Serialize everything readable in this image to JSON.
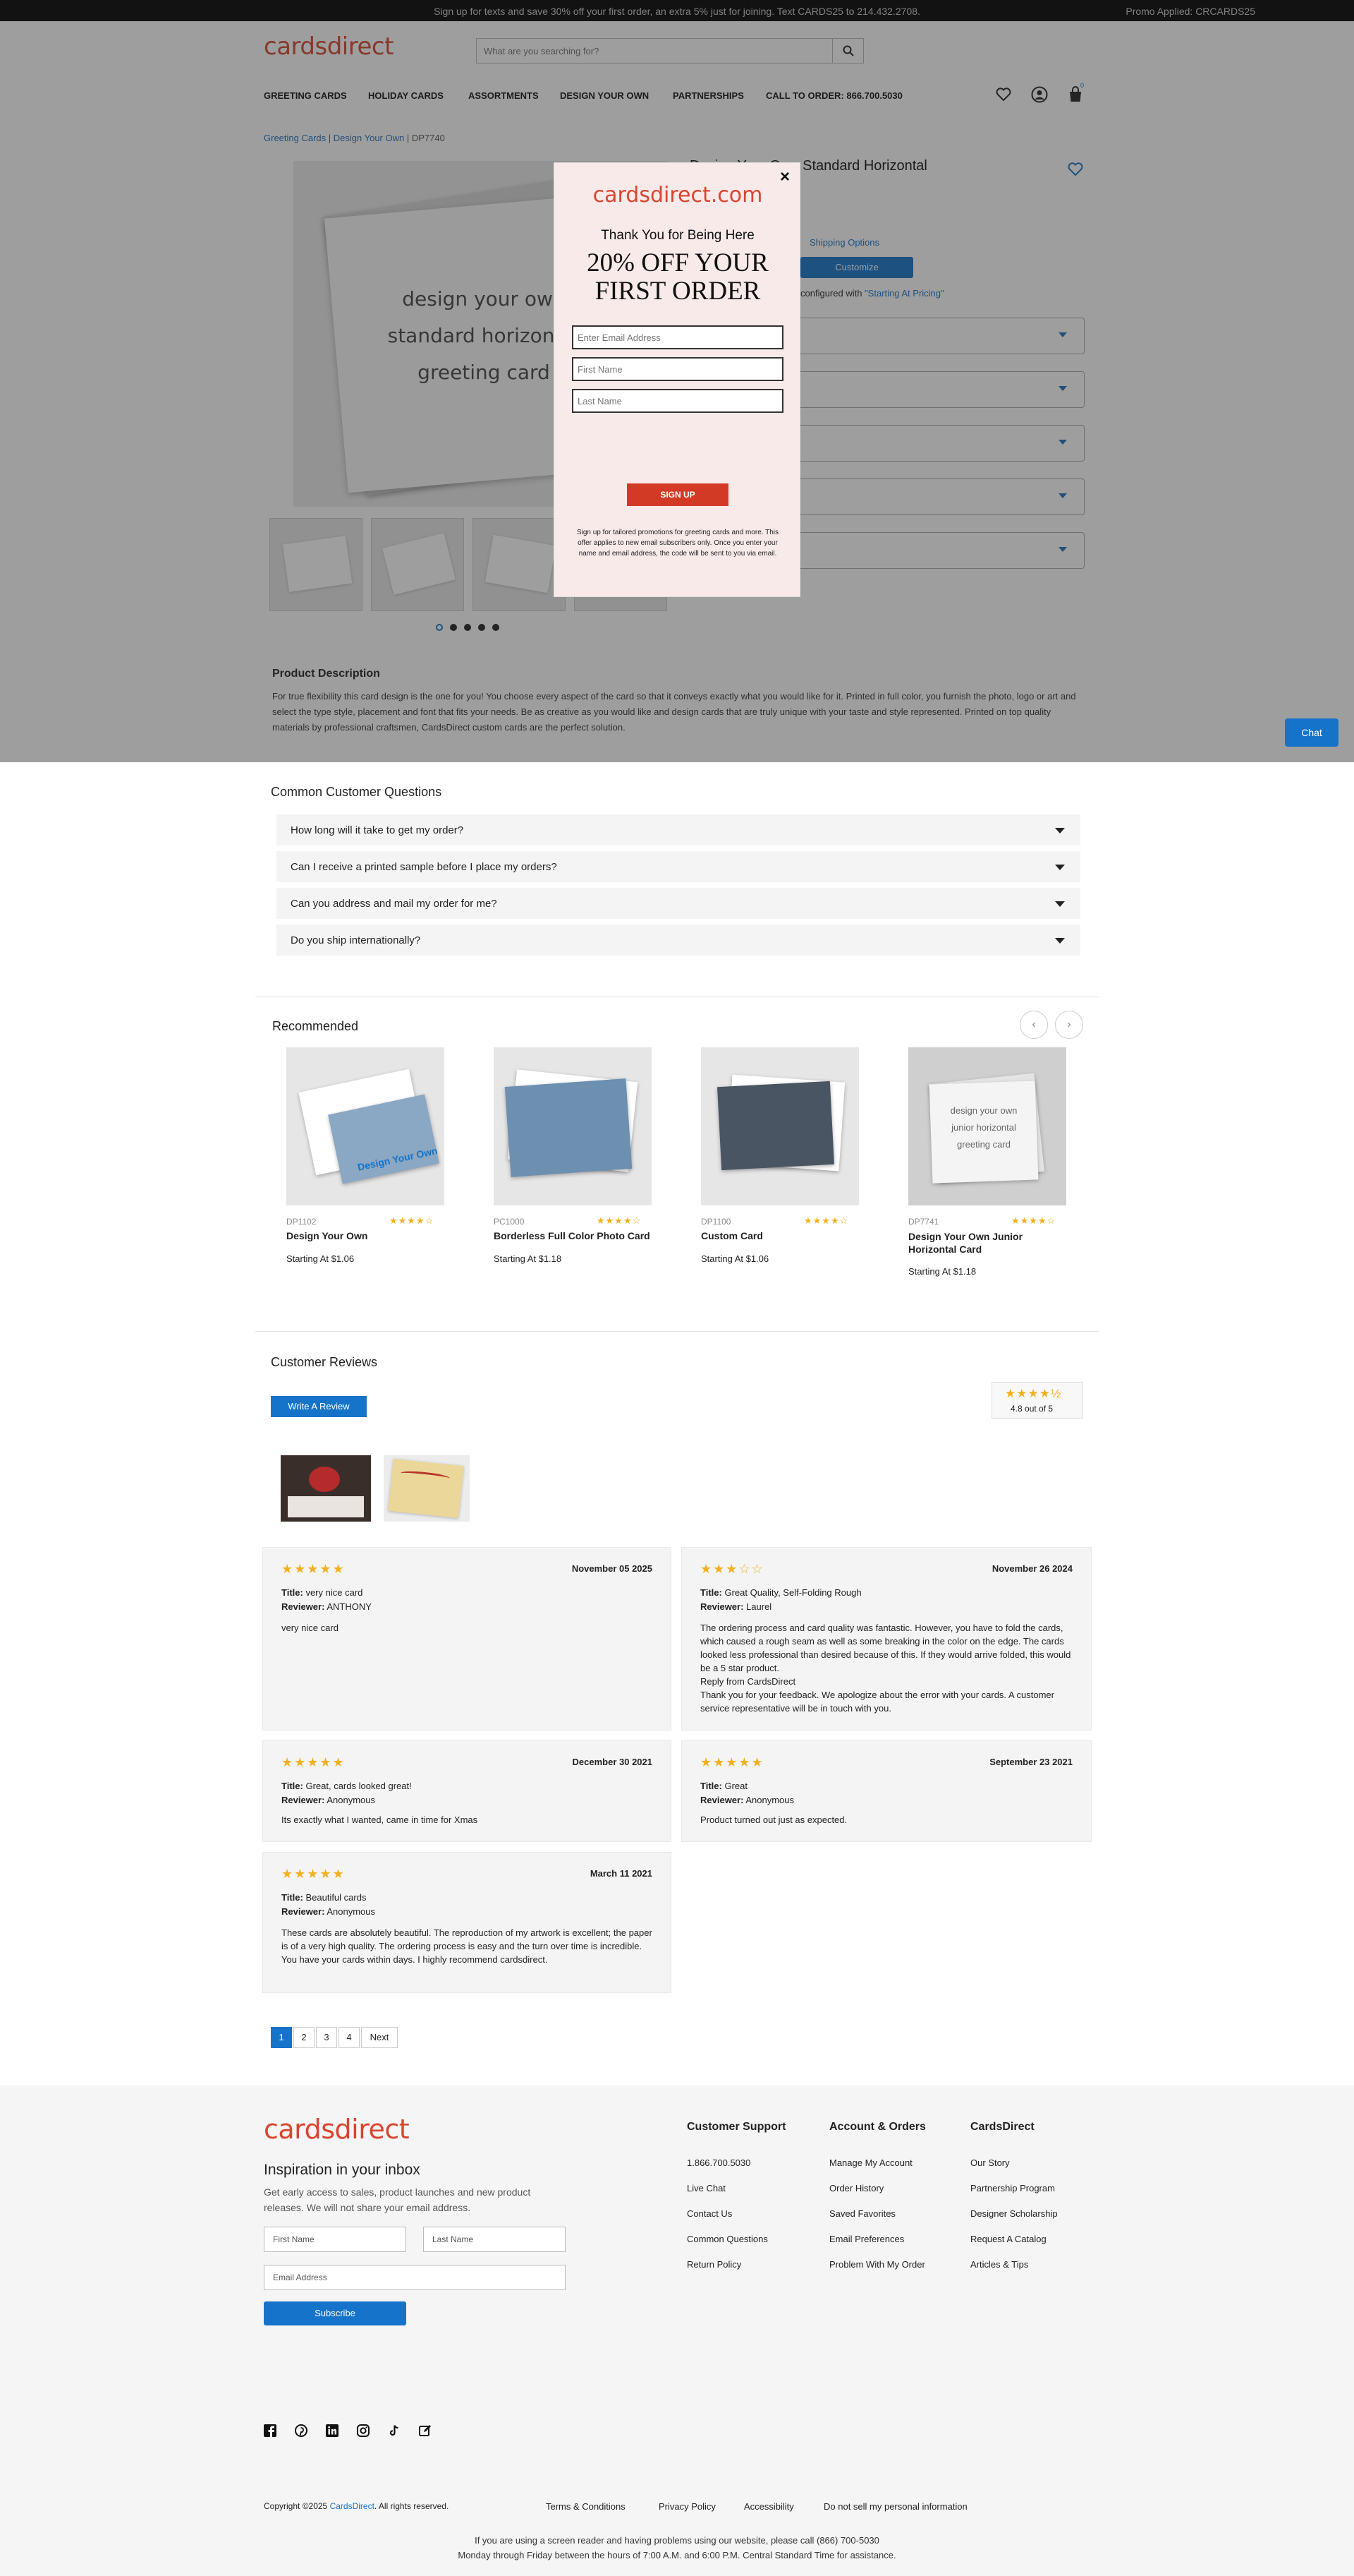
{
  "topbar": {
    "message": "Sign up for texts and save 30% off your first order, an extra 5% just for joining. Text CARDS25 to 214.432.2708.",
    "promo": "Promo Applied: CRCARDS25"
  },
  "header": {
    "logo": "cardsdirect",
    "search_placeholder": "What are you searching for?",
    "cart_count": "0"
  },
  "nav": [
    "GREETING CARDS",
    "HOLIDAY CARDS",
    "ASSORTMENTS",
    "DESIGN YOUR OWN",
    "PARTNERSHIPS",
    "CALL TO ORDER: 866.700.5030"
  ],
  "breadcrumb": {
    "a": "Greeting Cards",
    "sep1": " | ",
    "b": "Design Your Own",
    "sep2": " | ",
    "c": "DP7740"
  },
  "product": {
    "title": "Design Your Own Standard Horizontal",
    "image_text": [
      "design your own",
      "standard horizontal",
      "greeting card"
    ],
    "shipping_link": "Shipping Options",
    "customize": "Customize",
    "configured_pre": "configured with ",
    "configured_link": "\"Starting At Pricing\"",
    "description_title": "Product Description",
    "description": "For true flexibility this card design is the one for you! You choose every aspect of the card so that it conveys exactly what you would like for it. Printed in full color, you furnish the photo, logo or art and select the type style, placement and font that fits your needs. Be as creative as you would like and design cards that are truly unique with your taste and style represented. Printed on top quality materials by professional craftsmen, CardsDirect custom cards are the perfect solution."
  },
  "chat": "Chat",
  "modal": {
    "logo": "cardsdirect.com",
    "thanks": "Thank You for Being Here",
    "offer_line1": "20% OFF YOUR",
    "offer_line2": "FIRST ORDER",
    "email_placeholder": "Enter Email Address",
    "first_placeholder": "First Name",
    "last_placeholder": "Last Name",
    "signup": "SIGN UP",
    "fine_print": "Sign up for tailored promotions for greeting cards and more. This offer applies to new email subscribers only. Once you enter your name and email address, the code will be sent to you via email."
  },
  "questions": {
    "title": "Common Customer Questions",
    "items": [
      "How long will it take to get my order?",
      "Can I receive a printed sample before I place my orders?",
      "Can you address and mail my order for me?",
      "Do you ship internationally?"
    ]
  },
  "recommended": {
    "title": "Recommended",
    "items": [
      {
        "sku": "DP1102",
        "name": "Design Your Own",
        "price": "Starting At $1.06",
        "stars": "★★★★☆",
        "art": "Design Your Own"
      },
      {
        "sku": "PC1000",
        "name": "Borderless Full Color Photo Card",
        "price": "Starting At $1.18",
        "stars": "★★★★☆"
      },
      {
        "sku": "DP1100",
        "name": "Custom Card",
        "price": "Starting At $1.06",
        "stars": "★★★★☆"
      },
      {
        "sku": "DP7741",
        "name": "Design Your Own Junior Horizontal Card",
        "price": "Starting At $1.18",
        "stars": "★★★★☆",
        "art1": "design your own",
        "art2": "junior horizontal",
        "art3": "greeting card"
      }
    ]
  },
  "reviews": {
    "title": "Customer Reviews",
    "write": "Write A Review",
    "rating": "4.8",
    "out_of": "out of",
    "max": "5",
    "summary_stars": "★★★★½",
    "title_label": "Title:",
    "reviewer_label": "Reviewer:",
    "items": [
      {
        "stars": "★★★★★",
        "date": "November 05 2025",
        "title": "very nice card",
        "reviewer": "ANTHONY",
        "body": "very nice card"
      },
      {
        "stars": "★★★☆☆",
        "date": "November 26 2024",
        "title": "Great Quality, Self-Folding Rough",
        "reviewer": "Laurel",
        "body": "The ordering process and card quality was fantastic. However, you have to fold the cards, which caused a rough seam as well as some breaking in the color on the edge. The cards looked less professional than desired because of this. If they would arrive folded, this would be a 5 star product.",
        "reply_label": "Reply from CardsDirect",
        "reply": "Thank you for your feedback. We apologize about the error with your cards. A customer service representative will be in touch with you."
      },
      {
        "stars": "★★★★★",
        "date": "December 30 2021",
        "title": "Great, cards looked great!",
        "reviewer": "Anonymous",
        "body": "Its exactly what I wanted, came in time for Xmas"
      },
      {
        "stars": "★★★★★",
        "date": "September 23 2021",
        "title": "Great",
        "reviewer": "Anonymous",
        "body": "Product turned out just as expected."
      },
      {
        "stars": "★★★★★",
        "date": "March 11 2021",
        "title": "Beautiful cards",
        "reviewer": "Anonymous",
        "body": "These cards are absolutely beautiful. The reproduction of my artwork is excellent; the paper is of a very high quality. The ordering process is easy and the turn over time is incredible. You have your cards within days. I highly recommend cardsdirect."
      }
    ],
    "pages": [
      "1",
      "2",
      "3",
      "4",
      "Next"
    ]
  },
  "footer": {
    "logo": "cardsdirect",
    "inbox_title": "Inspiration in your inbox",
    "inbox_text1": "Get early access to sales, product launches and new product",
    "inbox_text2": "releases. We will not share your email address.",
    "first_name": "First Name",
    "last_name": "Last Name",
    "email": "Email Address",
    "subscribe": "Subscribe",
    "cols": [
      {
        "title": "Customer Support",
        "links": [
          "1.866.700.5030",
          "Live Chat",
          "Contact Us",
          "Common Questions",
          "Return Policy"
        ]
      },
      {
        "title": "Account & Orders",
        "links": [
          "Manage My Account",
          "Order History",
          "Saved Favorites",
          "Email Preferences",
          "Problem With My Order"
        ]
      },
      {
        "title": "CardsDirect",
        "links": [
          "Our Story",
          "Partnership Program",
          "Designer Scholarship",
          "Request A Catalog",
          "Articles & Tips"
        ]
      }
    ],
    "copyright_pre": "Copyright ©2025 ",
    "copyright_link": "CardsDirect",
    "copyright_post": ". All rights reserved.",
    "legal": [
      "Terms & Conditions",
      "Privacy Policy",
      "Accessibility",
      "Do not sell my personal information"
    ],
    "access1": "If you are using a screen reader and having problems using our website, please call (866) 700-5030",
    "access2": "Monday through Friday between the hours of 7:00 A.M. and 6:00 P.M. Central Standard Time for assistance."
  }
}
